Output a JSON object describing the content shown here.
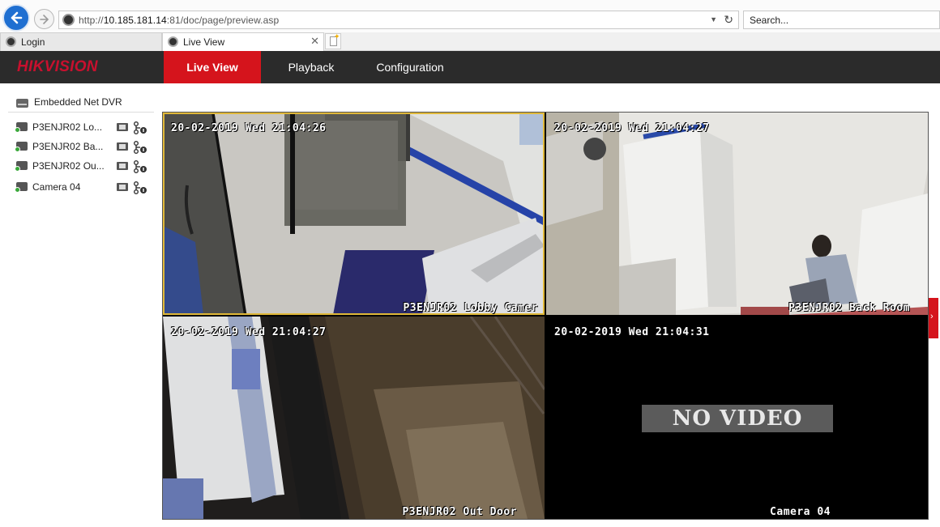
{
  "browser": {
    "url_prefix": "http://",
    "url_host": "10.185.181.14",
    "url_rest": ":81/doc/page/preview.asp",
    "search_placeholder": "Search...",
    "tabs": [
      {
        "label": "Login"
      },
      {
        "label": "Live View"
      }
    ]
  },
  "app": {
    "logo": "HIKVISION",
    "nav": {
      "live_view": "Live View",
      "playback": "Playback",
      "configuration": "Configuration"
    },
    "accent_color": "#d5141c"
  },
  "sidebar": {
    "device": "Embedded Net DVR",
    "cameras": [
      {
        "label": "P3ENJR02 Lo..."
      },
      {
        "label": "P3ENJR02 Ba..."
      },
      {
        "label": "P3ENJR02 Ou..."
      },
      {
        "label": "Camera 04"
      }
    ]
  },
  "video": {
    "cells": [
      {
        "timestamp": "20-02-2019 Wed 21:04:26",
        "name": "P3ENJR02 Lobby Camer",
        "selected": true
      },
      {
        "timestamp": "20-02-2019 Wed 21:04:27",
        "name": "P3ENJR02 Back Room"
      },
      {
        "timestamp": "20-02-2019 Wed 21:04:27",
        "name": "P3ENJR02 Out Door"
      },
      {
        "timestamp": "20-02-2019 Wed 21:04:31",
        "name": "Camera 04",
        "status": "NO VIDEO"
      }
    ]
  }
}
